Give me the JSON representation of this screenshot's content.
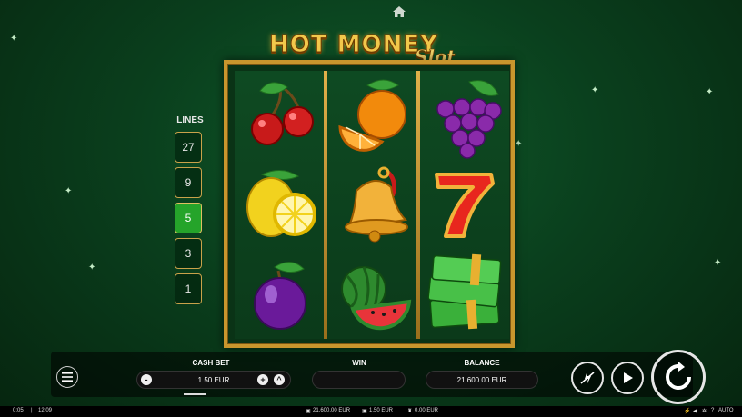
{
  "game": {
    "logo_main": "HOT MONEY",
    "logo_sub": "Slot",
    "lines_label": "LINES",
    "lines": [
      {
        "label": "27",
        "active": false
      },
      {
        "label": "9",
        "active": false
      },
      {
        "label": "5",
        "active": true
      },
      {
        "label": "3",
        "active": false
      },
      {
        "label": "1",
        "active": false
      }
    ],
    "reels": [
      [
        "cherries-icon",
        "lemon-icon",
        "plum-icon"
      ],
      [
        "orange-icon",
        "bell-icon",
        "watermelon-icon"
      ],
      [
        "grapes-icon",
        "seven-icon",
        "money-stack-icon"
      ]
    ]
  },
  "bar": {
    "cash_bet_label": "CASH BET",
    "cash_bet_value": "1.50 EUR",
    "minus_label": "-",
    "plus_label": "+",
    "up_label": "^",
    "win_label": "WIN",
    "win_value": "",
    "balance_label": "BALANCE",
    "balance_value": "21,600.00 EUR"
  },
  "status": {
    "time_elapsed": "0:05",
    "separator": "|",
    "clock": "12:09",
    "balance": "21,600.00 EUR",
    "bet": "1.50 EUR",
    "win": "0.00 EUR",
    "auto_label": "AUTO",
    "help_label": "?"
  },
  "colors": {
    "background": "#0a3f1d",
    "frame_gold": "#c9962d",
    "active_line": "#25a42a"
  }
}
